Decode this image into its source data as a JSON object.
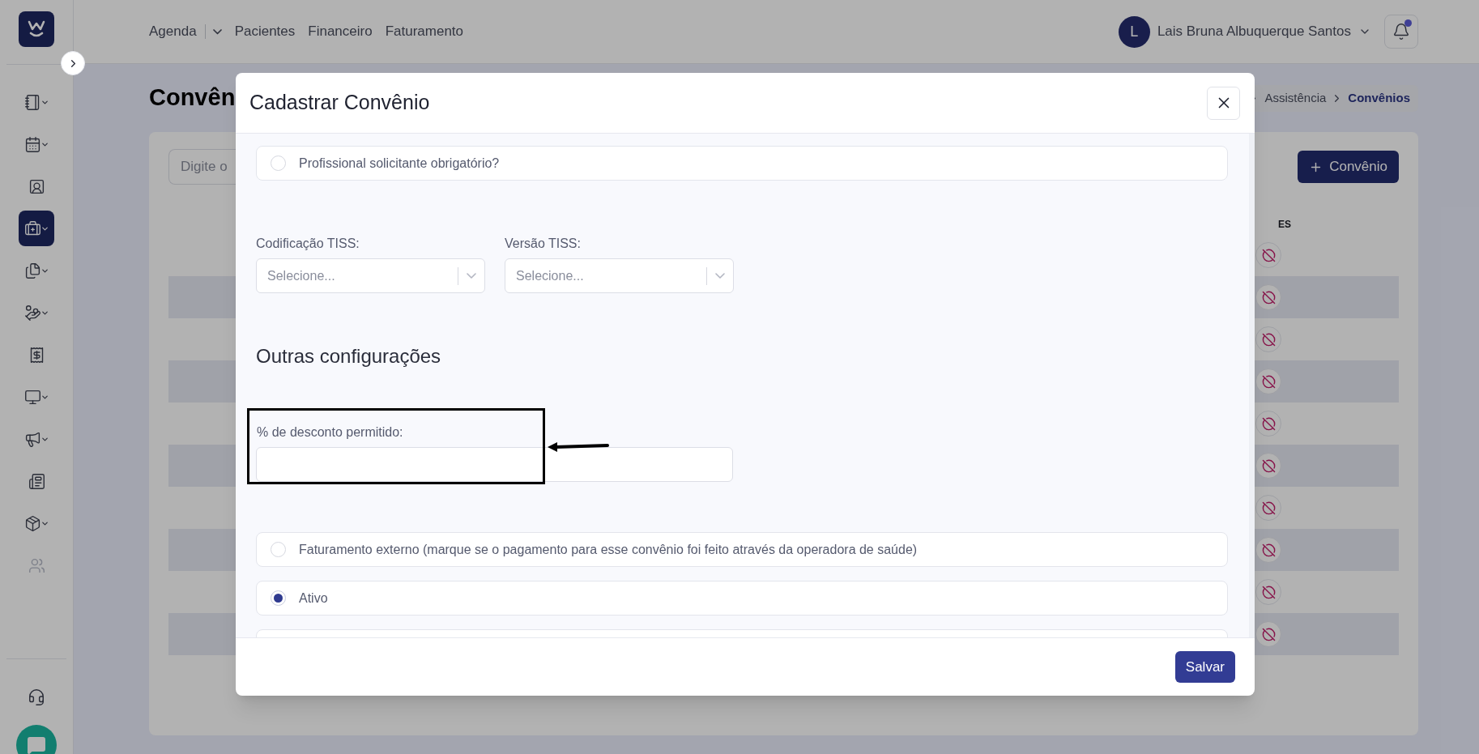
{
  "sidebar": {
    "items": [
      {
        "selected": false,
        "dropdown": true,
        "disabled": false
      },
      {
        "selected": false,
        "dropdown": true,
        "disabled": false
      },
      {
        "selected": false,
        "dropdown": false,
        "disabled": false
      },
      {
        "selected": true,
        "dropdown": true,
        "disabled": false
      },
      {
        "selected": false,
        "dropdown": true,
        "disabled": false
      },
      {
        "selected": false,
        "dropdown": true,
        "disabled": false
      },
      {
        "selected": false,
        "dropdown": false,
        "disabled": false
      },
      {
        "selected": false,
        "dropdown": true,
        "disabled": false
      },
      {
        "selected": false,
        "dropdown": true,
        "disabled": false
      },
      {
        "selected": false,
        "dropdown": false,
        "disabled": false
      },
      {
        "selected": false,
        "dropdown": true,
        "disabled": false
      },
      {
        "selected": false,
        "dropdown": false,
        "disabled": true
      }
    ]
  },
  "nav": {
    "items": [
      {
        "label": "Agenda",
        "dropdown": true
      },
      {
        "label": "Pacientes",
        "dropdown": false
      },
      {
        "label": "Financeiro",
        "dropdown": false
      },
      {
        "label": "Faturamento",
        "dropdown": false
      }
    ]
  },
  "user": {
    "initial": "L",
    "name": "Lais Bruna Albuquerque Santos"
  },
  "notifications": {
    "unread": true
  },
  "page": {
    "title": "Convên",
    "breadcrumb": [
      "Assistência",
      "Convênios"
    ],
    "search": {
      "placeholder": "Digite o"
    },
    "add_button": {
      "label": "Convênio"
    },
    "table": {
      "column_header": "ES",
      "rows": [
        {
          "kind": "action_row"
        },
        {
          "kind": "action_row"
        },
        {
          "kind": "action_row"
        },
        {
          "kind": "action_row"
        },
        {
          "kind": "action_row"
        },
        {
          "kind": "action_row"
        },
        {
          "kind": "action_row"
        },
        {
          "kind": "action_row"
        },
        {
          "kind": "action_row"
        },
        {
          "kind": "action_row"
        }
      ]
    }
  },
  "modal": {
    "title": "Cadastrar Convênio",
    "sections": [
      {
        "kind": "checkbox",
        "label": "Profissional solicitante obrigatório?",
        "checked": false
      },
      {
        "kind": "selects",
        "items": [
          {
            "label": "Codificação TISS:",
            "placeholder": "Selecione..."
          },
          {
            "label": "Versão TISS:",
            "placeholder": "Selecione..."
          }
        ]
      },
      {
        "kind": "heading",
        "text": "Outras configurações"
      },
      {
        "kind": "input",
        "label": "% de desconto permitido:",
        "highlighted": true
      },
      {
        "kind": "checkbox",
        "label": "Faturamento externo (marque se o pagamento para esse convênio foi feito através da operadora de saúde)",
        "checked": false
      },
      {
        "kind": "checkbox",
        "label": "Ativo",
        "checked": true
      },
      {
        "kind": "partial"
      }
    ],
    "save_button": "Salvar"
  }
}
